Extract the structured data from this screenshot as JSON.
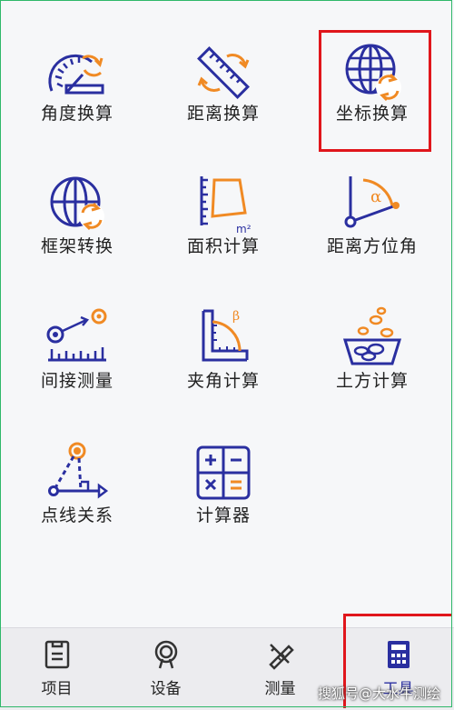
{
  "tools": [
    {
      "label": "角度换算",
      "icon": "angle-conversion-icon"
    },
    {
      "label": "距离换算",
      "icon": "distance-conversion-icon"
    },
    {
      "label": "坐标换算",
      "icon": "coordinate-conversion-icon"
    },
    {
      "label": "框架转换",
      "icon": "frame-conversion-icon"
    },
    {
      "label": "面积计算",
      "icon": "area-calculation-icon"
    },
    {
      "label": "距离方位角",
      "icon": "distance-azimuth-icon"
    },
    {
      "label": "间接测量",
      "icon": "indirect-measurement-icon"
    },
    {
      "label": "夹角计算",
      "icon": "included-angle-icon"
    },
    {
      "label": "土方计算",
      "icon": "earthwork-icon"
    },
    {
      "label": "点线关系",
      "icon": "point-line-icon"
    },
    {
      "label": "计算器",
      "icon": "calculator-icon"
    }
  ],
  "tabs": [
    {
      "label": "项目",
      "icon": "project-icon"
    },
    {
      "label": "设备",
      "icon": "device-icon"
    },
    {
      "label": "测量",
      "icon": "survey-icon"
    },
    {
      "label": "工具",
      "icon": "tools-icon",
      "active": true
    }
  ],
  "icon_glyphs": {
    "alpha": "α",
    "beta": "β",
    "m2": "m²"
  },
  "watermark": "搜狐号@大水牛测绘",
  "colors": {
    "navy": "#2a2fa0",
    "orange": "#f08a24",
    "highlight": "#e0161c"
  }
}
